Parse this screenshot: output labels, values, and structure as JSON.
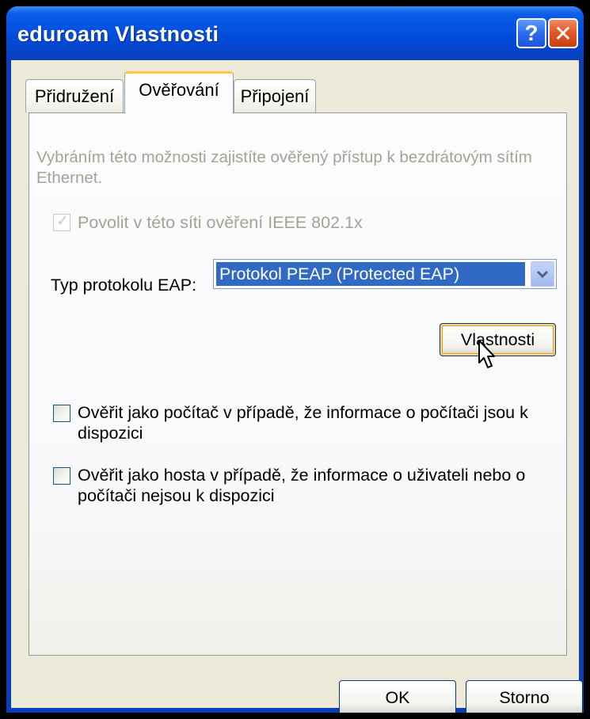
{
  "window": {
    "title": "eduroam Vlastnosti",
    "help_glyph": "?",
    "close_glyph": "✕",
    "title_color": "#0450df"
  },
  "tabs": [
    {
      "label": "Přidružení",
      "selected": false
    },
    {
      "label": "Ověřování",
      "selected": true
    },
    {
      "label": "Připojení",
      "selected": false
    }
  ],
  "authentication": {
    "description": "Vybráním této možnosti zajistíte ověřený přístup k bezdrátovým sítím Ethernet.",
    "enable_8021x": {
      "label": "Povolit v této síti ověření IEEE 802.1x",
      "checked": true,
      "disabled": true
    },
    "eap_type_label": "Typ protokolu EAP:",
    "eap_type_value": "Protokol PEAP (Protected EAP)",
    "properties_button": "Vlastnosti",
    "auth_as_computer": {
      "label": "Ověřit jako počítač v případě, že informace o počítači jsou k dispozici",
      "checked": false
    },
    "auth_as_guest": {
      "label": "Ověřit jako hosta v případě, že informace o uživateli nebo o počítači nejsou k dispozici",
      "checked": false
    }
  },
  "footer": {
    "ok_label": "OK",
    "cancel_label": "Storno"
  },
  "icons": {
    "help": "help-icon",
    "close": "close-icon",
    "dropdown": "chevron-down-icon",
    "cursor": "mouse-cursor-icon"
  }
}
